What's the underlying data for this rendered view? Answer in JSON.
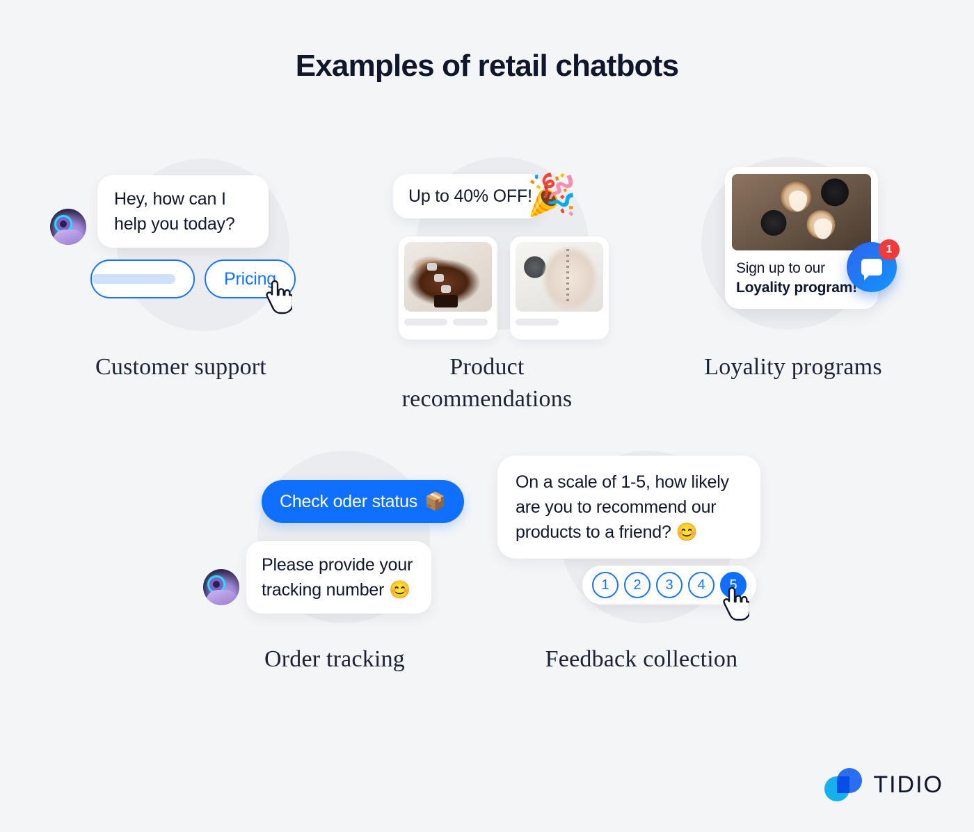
{
  "page": {
    "title": "Examples of retail chatbots",
    "background_color": "#f4f5f7",
    "accent_blue": "#0f6fff",
    "accent_outline_blue": "#1573ff",
    "badge_red": "#f33a3a",
    "text_dark": "#10172a"
  },
  "cards": {
    "customer_support": {
      "caption": "Customer support",
      "avatar_name": "chatbot-avatar",
      "bubble_text": "Hey, how can I help you today?",
      "quick_replies": [
        {
          "label": "",
          "type": "placeholder"
        },
        {
          "label": "Pricing",
          "type": "button"
        }
      ],
      "cursor": "hand-pointer"
    },
    "product_recommendations": {
      "caption_line1": "Product",
      "caption_line2": "recommendations",
      "promo_text": "Up to 40% OFF!",
      "promo_emoji": "🎉",
      "products": [
        {
          "alt": "brown snake-print buckled ankle boot"
        },
        {
          "alt": "cream studded heeled ankle boot"
        }
      ]
    },
    "loyality_programs": {
      "caption": "Loyality programs",
      "photo_alt": "hands toasting with latte art coffee cups",
      "text_line1": "Sign up to our",
      "text_line2": "Loyality program!",
      "fab_icon": "chat-bubble-icon",
      "badge_count": "1"
    },
    "order_tracking": {
      "caption": "Order tracking",
      "user_reply": "Check oder status",
      "user_reply_emoji": "📦",
      "bot_text": "Please provide your tracking number",
      "bot_emoji": "😊",
      "avatar_name": "chatbot-avatar"
    },
    "feedback_collection": {
      "caption": "Feedback collection",
      "question": "On a scale of 1-5, how likely are you to recommend our products to a friend?",
      "question_emoji": "😊",
      "ratings": [
        "1",
        "2",
        "3",
        "4",
        "5"
      ],
      "selected_rating": "5",
      "cursor": "hand-pointer"
    }
  },
  "logo": {
    "wordmark": "TIDIO",
    "mark_name": "tidio-logo-mark"
  }
}
